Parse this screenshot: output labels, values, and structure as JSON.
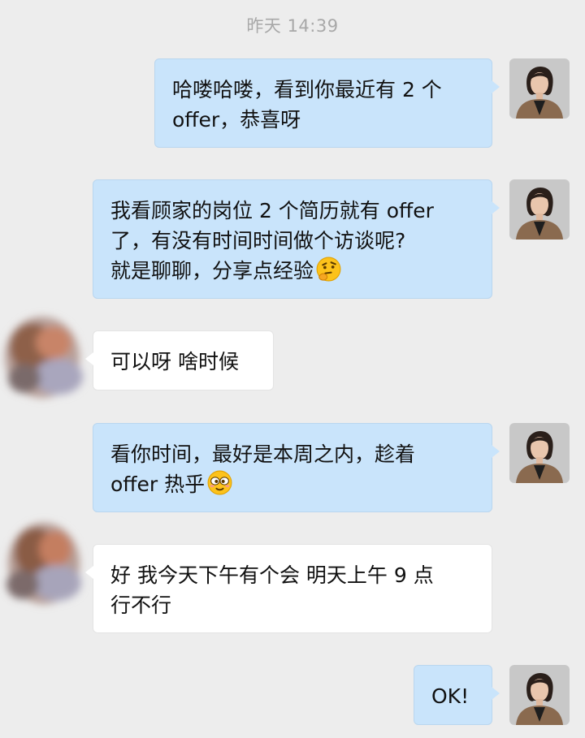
{
  "chat": {
    "timestamp": "昨天 14:39",
    "messages": [
      {
        "sender": "me",
        "text": "哈喽哈喽，看到你最近有 2 个\noffer，恭喜呀"
      },
      {
        "sender": "me",
        "text": "我看顾家的岗位 2 个简历就有 offer\n了，有没有时间时间做个访谈呢?\n就是聊聊，分享点经验",
        "emoji": "thinking-face-emoji"
      },
      {
        "sender": "other",
        "text": "可以呀 啥时候"
      },
      {
        "sender": "me",
        "text": "看你时间，最好是本周之内，趁着\noffer 热乎",
        "emoji": "goofy-face-emoji"
      },
      {
        "sender": "other",
        "text": "好 我今天下午有个会 明天上午 9 点\n行不行"
      },
      {
        "sender": "me",
        "text": "OK!"
      }
    ]
  },
  "colors": {
    "background": "#ededed",
    "my_bubble": "#c9e4fb",
    "other_bubble": "#ffffff",
    "timestamp_text": "#a8a8a8"
  }
}
